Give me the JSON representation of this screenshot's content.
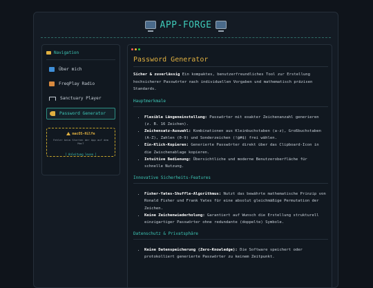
{
  "header": {
    "title": "APP-FORGE"
  },
  "sidebar": {
    "nav_title": "Navigation",
    "items": [
      {
        "label": "Über mich",
        "icon": "info-icon"
      },
      {
        "label": "FreqPlay Radio",
        "icon": "radio-icon"
      },
      {
        "label": "Sanctuary Player",
        "icon": "headphones-icon"
      },
      {
        "label": "Password Generator",
        "icon": "key-icon"
      }
    ],
    "active_index": 3,
    "help": {
      "title": "macOS-Hilfe",
      "text": "Fehler beim Starten der App auf dem Mac?",
      "link": "[ Anleitung lesen ]"
    }
  },
  "content": {
    "window_dots": [
      "#ff5f56",
      "#ffbd2e",
      "#27c93f"
    ],
    "title": "Password Generator",
    "intro": {
      "lead": "Sicher & zuverlässig",
      "text": " Ein kompaktes, benutzerfreundliches Tool zur Erstellung hochsicherer Passwörter nach individuellen Vorgaben und mathematisch präzisen Standards."
    },
    "sections": [
      {
        "heading": "Hauptmerkmale",
        "items": [
          {
            "term": "Flexible Längeneinstellung:",
            "text": " Passwörter mit exakter Zeichenanzahl generieren (z. B. 16 Zeichen)."
          },
          {
            "term": "Zeichensatz-Auswahl:",
            "text": " Kombinationen aus Kleinbuchstaben (a-z), Großbuchstaben (A-Z), Zahlen (0-9) und Sonderzeichen (!@#$) frei wählen."
          },
          {
            "term": "Ein-Klick-Kopieren:",
            "text": " Generierte Passwörter direkt über das Clipboard-Icon in die Zwischenablage kopieren."
          },
          {
            "term": "Intuitive Bedienung:",
            "text": " Übersichtliche und moderne Benutzeroberfläche für schnelle Nutzung."
          }
        ]
      },
      {
        "heading": "Innovative Sicherheits-Features",
        "items": [
          {
            "term": "Fisher-Yates-Shuffle-Algorithmus:",
            "text": " Nutzt das bewährte mathematische Prinzip von Ronald Fisher und Frank Yates für eine absolut gleichmäßige Permutation der Zeichen."
          },
          {
            "term": "Keine Zeichenwiederholung:",
            "text": " Garantiert auf Wunsch die Erstellung strukturell einzigartiger Passwörter ohne redundante (doppelte) Symbole."
          }
        ]
      },
      {
        "heading": "Datenschutz & Privatsphäre",
        "items": [
          {
            "term": "Keine Datenspeicherung (Zero-Knowledge):",
            "text": " Die Software speichert oder protokolliert generierte Passwörter zu keinem Zeitpunkt."
          }
        ]
      }
    ]
  }
}
